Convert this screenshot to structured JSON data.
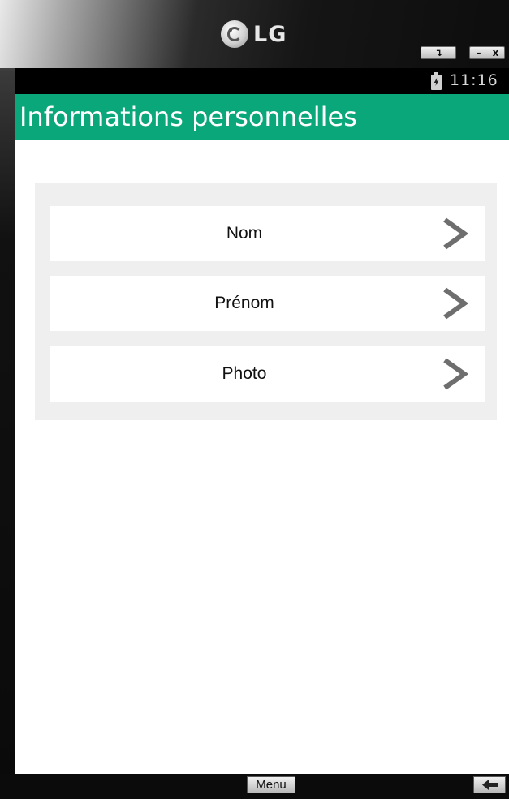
{
  "emulator": {
    "brand": "LG",
    "rotate_symbol": "↴",
    "minimize_symbol": "–",
    "close_symbol": "x",
    "menu_label": "Menu",
    "icons": [
      "lg-logo-icon",
      "rotate-icon",
      "minimize-icon",
      "close-icon",
      "back-arrow-icon"
    ]
  },
  "statusbar": {
    "time": "11:16",
    "icons": [
      "battery-charging-icon"
    ]
  },
  "appbar": {
    "title": "Informations personnelles",
    "color": "#0aa77a"
  },
  "list": {
    "items": [
      {
        "label": "Nom",
        "icon": "chevron-right-icon"
      },
      {
        "label": "Prénom",
        "icon": "chevron-right-icon"
      },
      {
        "label": "Photo",
        "icon": "chevron-right-icon"
      }
    ],
    "panel_color": "#efefef"
  }
}
